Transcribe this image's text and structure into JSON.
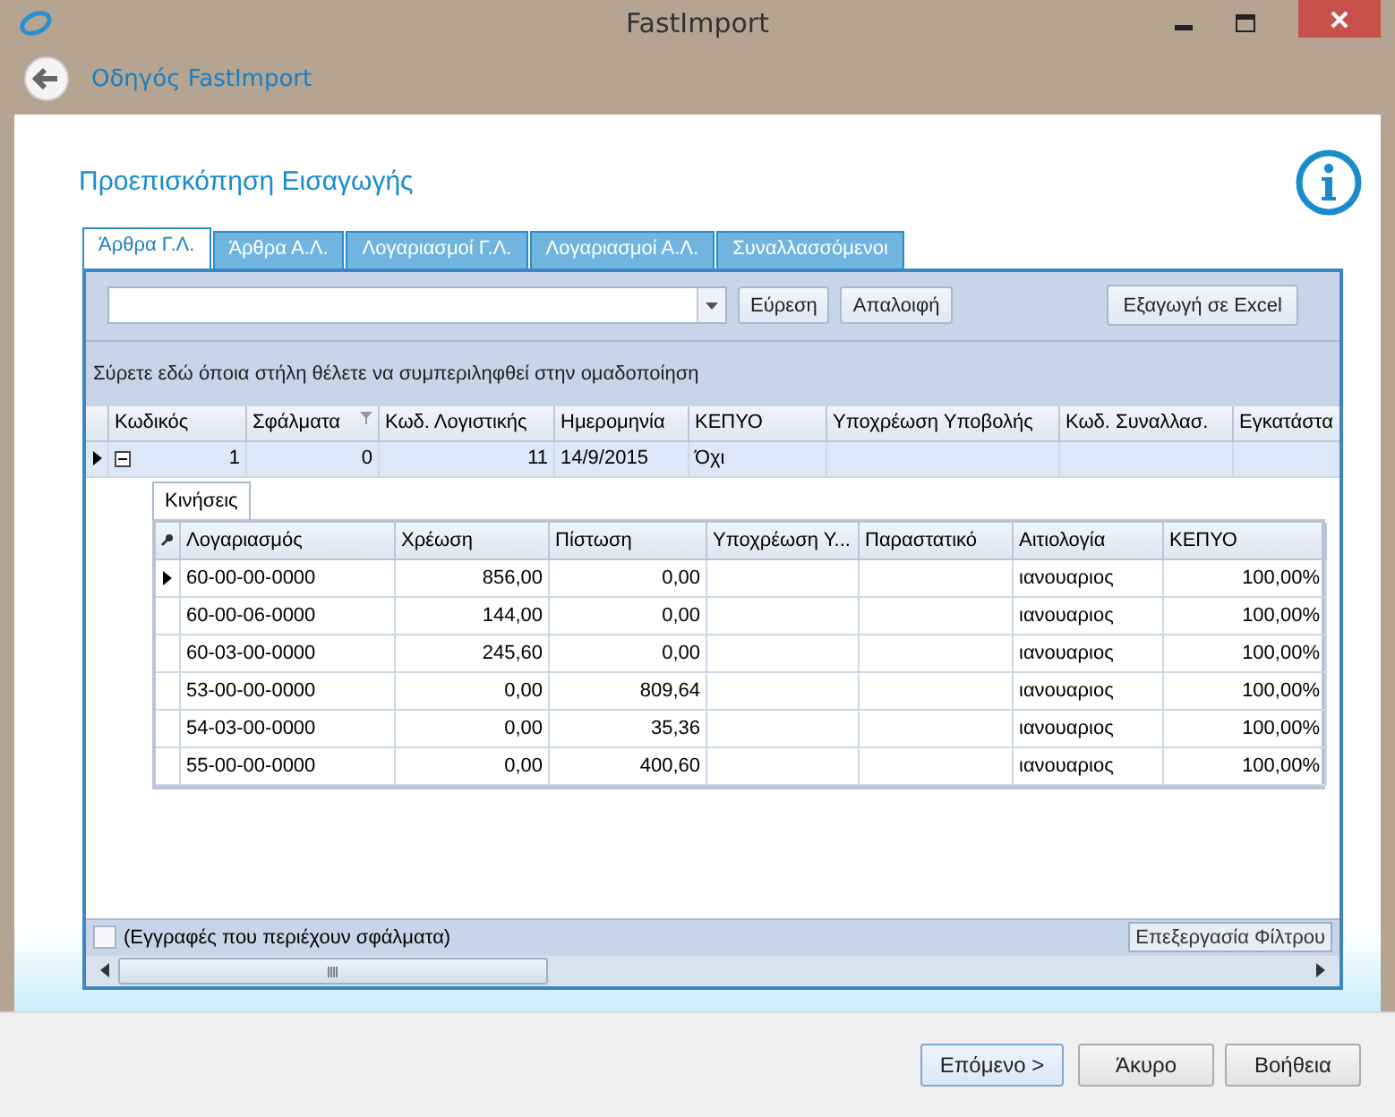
{
  "window": {
    "title": "FastImport"
  },
  "nav": {
    "title": "Οδηγός FastImport"
  },
  "heading": "Προεπισκόπηση Εισαγωγής",
  "tabs": [
    {
      "label": "Άρθρα Γ.Λ.",
      "selected": true
    },
    {
      "label": "Άρθρα Α.Λ.",
      "selected": false
    },
    {
      "label": "Λογαριασμοί Γ.Λ.",
      "selected": false
    },
    {
      "label": "Λογαριασμοί Α.Λ.",
      "selected": false
    },
    {
      "label": "Συναλλασσόμενοι",
      "selected": false
    }
  ],
  "toolbar": {
    "find": "Εύρεση",
    "clear": "Απαλοιφή",
    "export": "Εξαγωγή σε Excel"
  },
  "group_panel": "Σύρετε εδώ όποια στήλη θέλετε να συμπεριληφθεί στην ομαδοποίηση",
  "table": {
    "columns": [
      {
        "label": "Κωδικός",
        "filter": false
      },
      {
        "label": "Σφάλματα",
        "filter": true
      },
      {
        "label": "Κωδ. Λογιστικής",
        "filter": false
      },
      {
        "label": "Ημερομηνία",
        "filter": false
      },
      {
        "label": "ΚΕΠΥΟ",
        "filter": false
      },
      {
        "label": "Υποχρέωση Υποβολής",
        "filter": false
      },
      {
        "label": "Κωδ. Συναλλασ.",
        "filter": false
      },
      {
        "label": "Εγκατάστα",
        "filter": false
      }
    ],
    "rows": [
      {
        "selected": true,
        "expanded": true,
        "cells": [
          "1",
          "0",
          "11",
          "14/9/2015",
          "Όχι",
          "",
          "",
          ""
        ]
      }
    ]
  },
  "detail": {
    "tab": "Κινήσεις",
    "columns": [
      "Λογαριασμός",
      "Χρέωση",
      "Πίστωση",
      "Υποχρέωση Υ...",
      "Παραστατικό",
      "Αιτιολογία",
      "ΚΕΠΥΟ"
    ],
    "rows": [
      {
        "selected": true,
        "cells": [
          "60-00-00-0000",
          "856,00",
          "0,00",
          "",
          "",
          "ιανουαριος",
          "100,00%"
        ]
      },
      {
        "selected": false,
        "cells": [
          "60-00-06-0000",
          "144,00",
          "0,00",
          "",
          "",
          "ιανουαριος",
          "100,00%"
        ]
      },
      {
        "selected": false,
        "cells": [
          "60-03-00-0000",
          "245,60",
          "0,00",
          "",
          "",
          "ιανουαριος",
          "100,00%"
        ]
      },
      {
        "selected": false,
        "cells": [
          "53-00-00-0000",
          "0,00",
          "809,64",
          "",
          "",
          "ιανουαριος",
          "100,00%"
        ]
      },
      {
        "selected": false,
        "cells": [
          "54-03-00-0000",
          "0,00",
          "35,36",
          "",
          "",
          "ιανουαριος",
          "100,00%"
        ]
      },
      {
        "selected": false,
        "cells": [
          "55-00-00-0000",
          "0,00",
          "400,60",
          "",
          "",
          "ιανουαριος",
          "100,00%"
        ]
      }
    ]
  },
  "filter_bar": {
    "checked": false,
    "label": "(Εγγραφές που περιέχουν σφάλματα)",
    "edit_filter": "Επεξεργασία Φίλτρου"
  },
  "buttons": [
    "Επόμενο >",
    "Άκυρο",
    "Βοήθεια"
  ]
}
